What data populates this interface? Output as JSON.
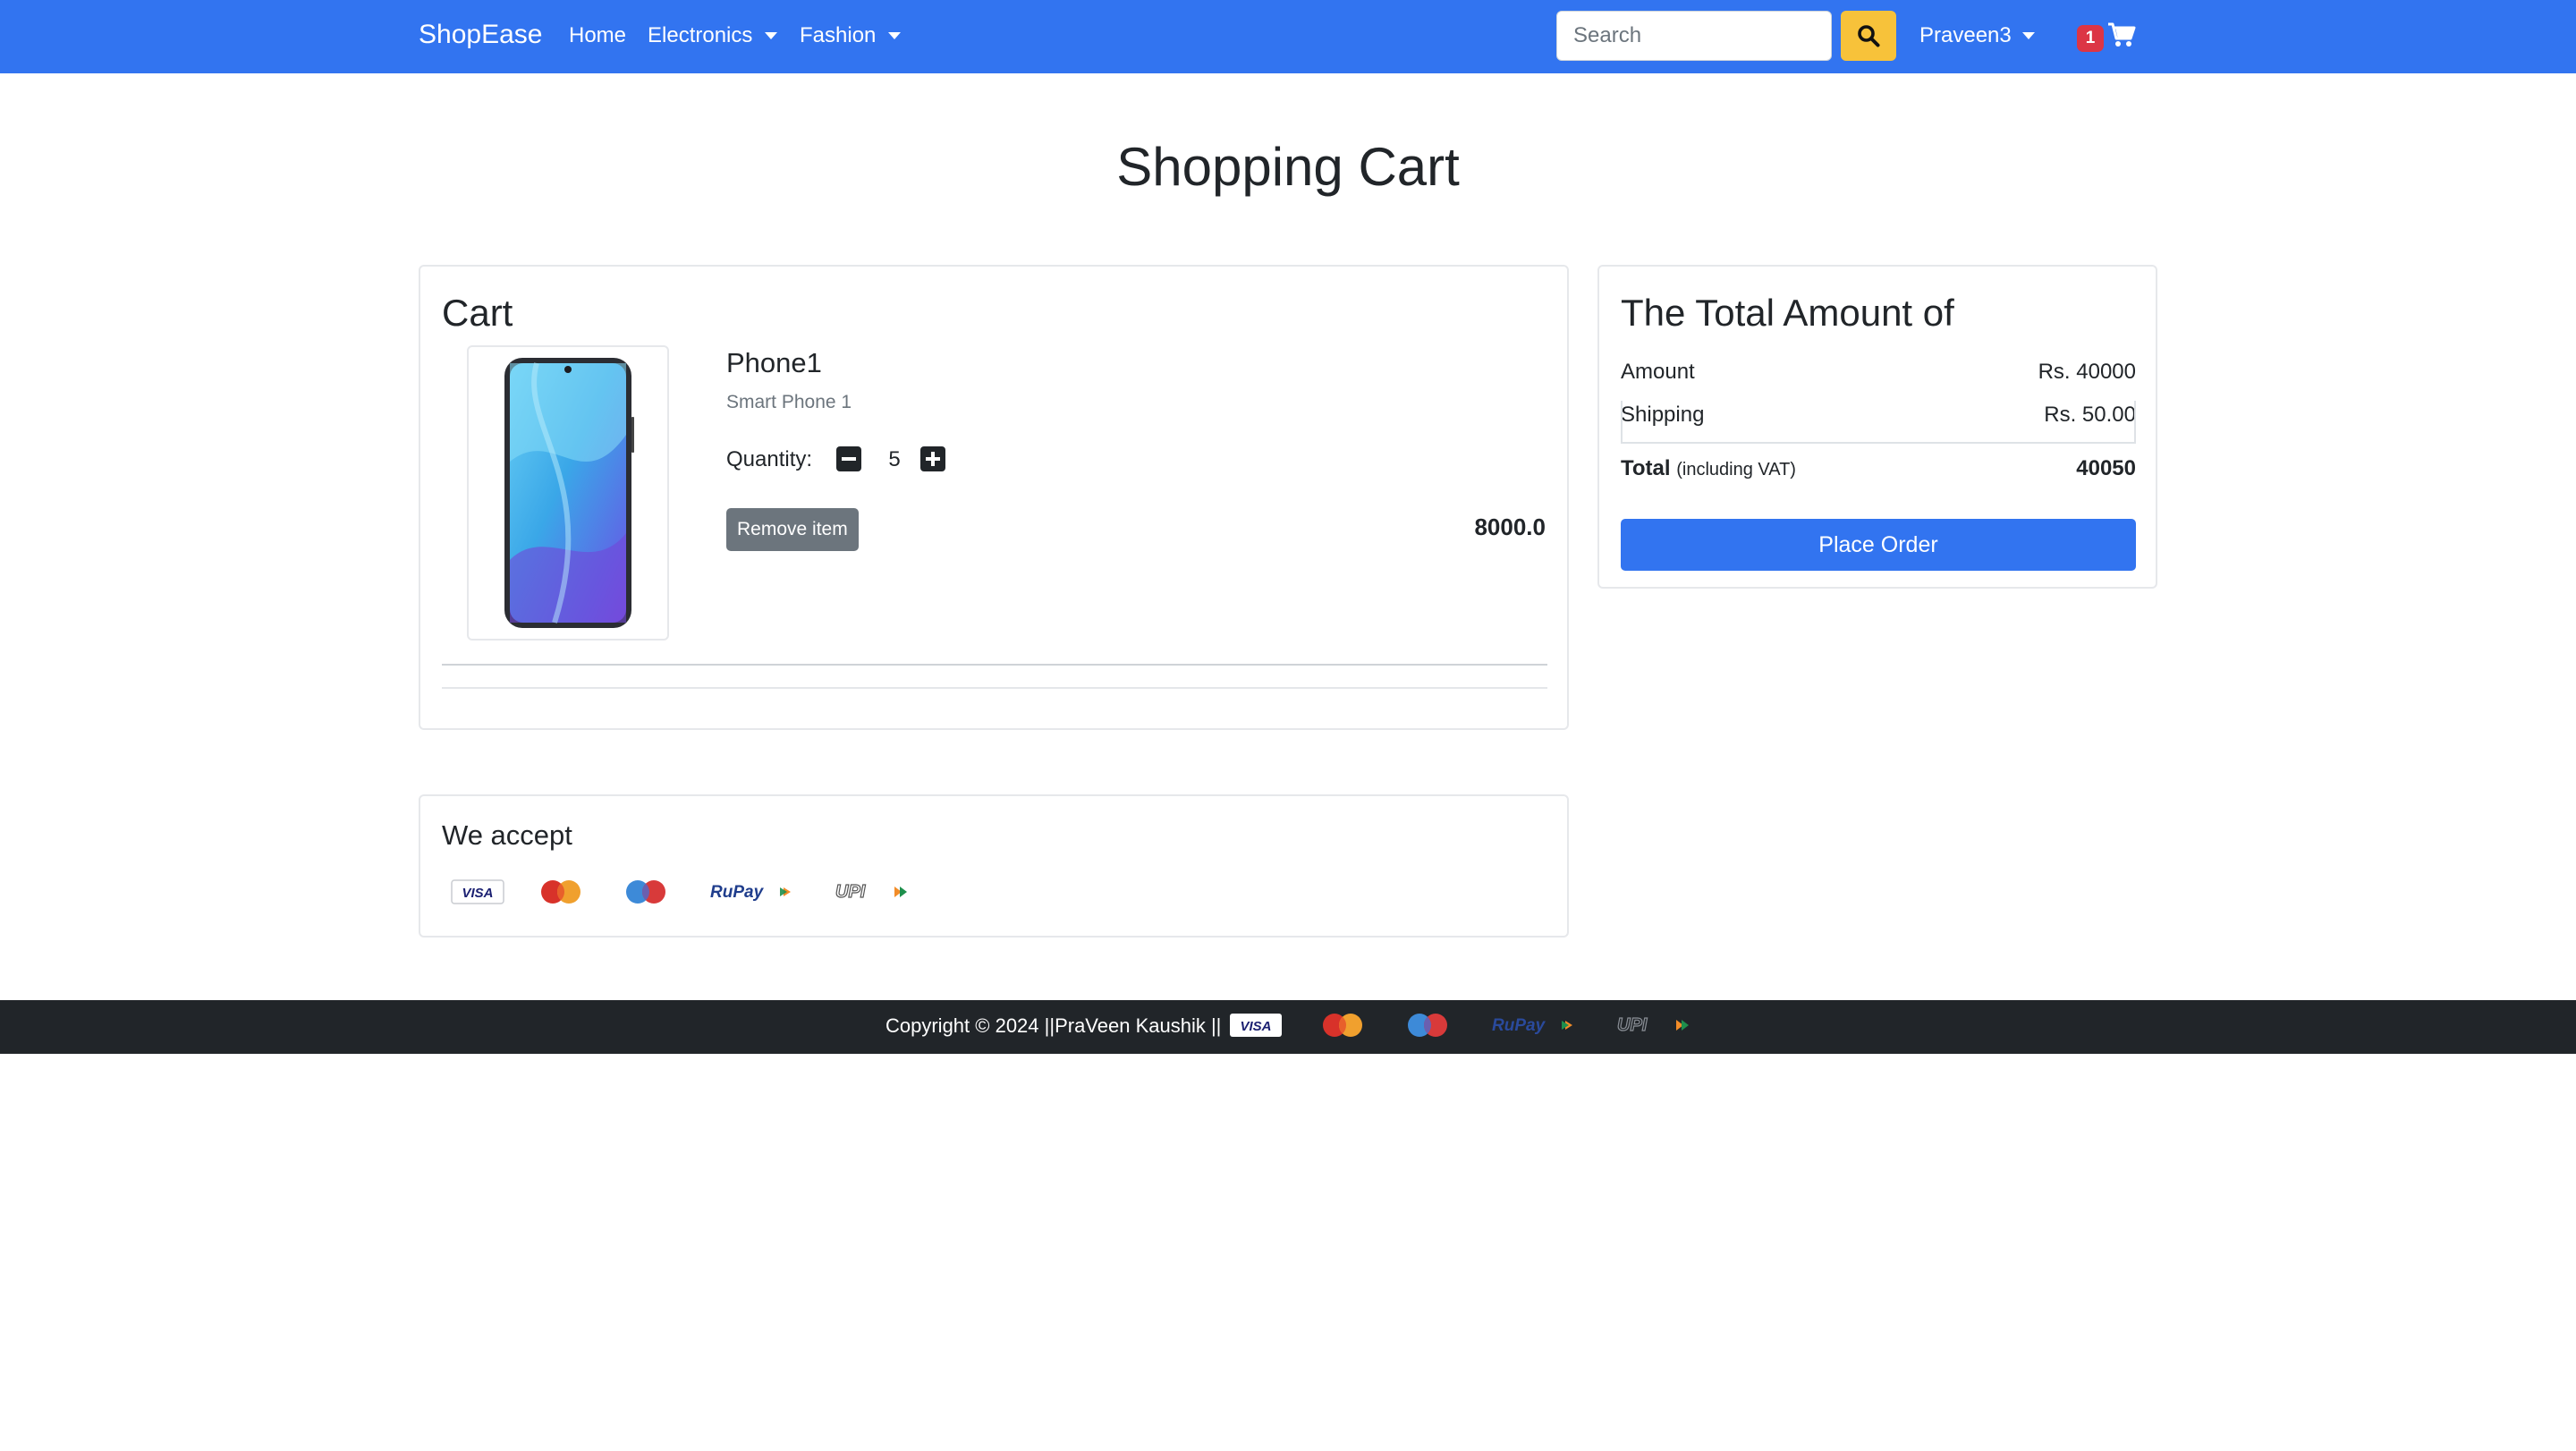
{
  "navbar": {
    "brand": "ShopEase",
    "links": [
      {
        "label": "Home"
      },
      {
        "label": "Electronics"
      },
      {
        "label": "Fashion"
      }
    ],
    "search_placeholder": "Search",
    "user": "Praveen3",
    "cart_count": "1",
    "bg_color": "#3274f0",
    "search_button_color": "#f7c23a"
  },
  "page": {
    "title": "Shopping Cart"
  },
  "cart": {
    "title": "Cart",
    "items": [
      {
        "name": "Phone1",
        "description": "Smart Phone 1",
        "quantity_label": "Quantity:",
        "quantity": "5",
        "remove_label": "Remove item",
        "price": "8000.0"
      }
    ]
  },
  "summary": {
    "title": "The Total Amount of",
    "amount_label": "Amount",
    "amount_value": "Rs. 40000",
    "shipping_label": "Shipping",
    "shipping_value": "Rs. 50.00",
    "total_label": "Total",
    "total_note": "(including VAT)",
    "total_value": "40050",
    "button_label": "Place Order"
  },
  "payments": {
    "title": "We accept",
    "methods": [
      "visa-logo",
      "mastercard-logo",
      "maestro-logo",
      "rupay-logo",
      "upi-logo"
    ]
  },
  "footer": {
    "text": "Copyright © 2024 ||PraVeen Kaushik ||"
  }
}
